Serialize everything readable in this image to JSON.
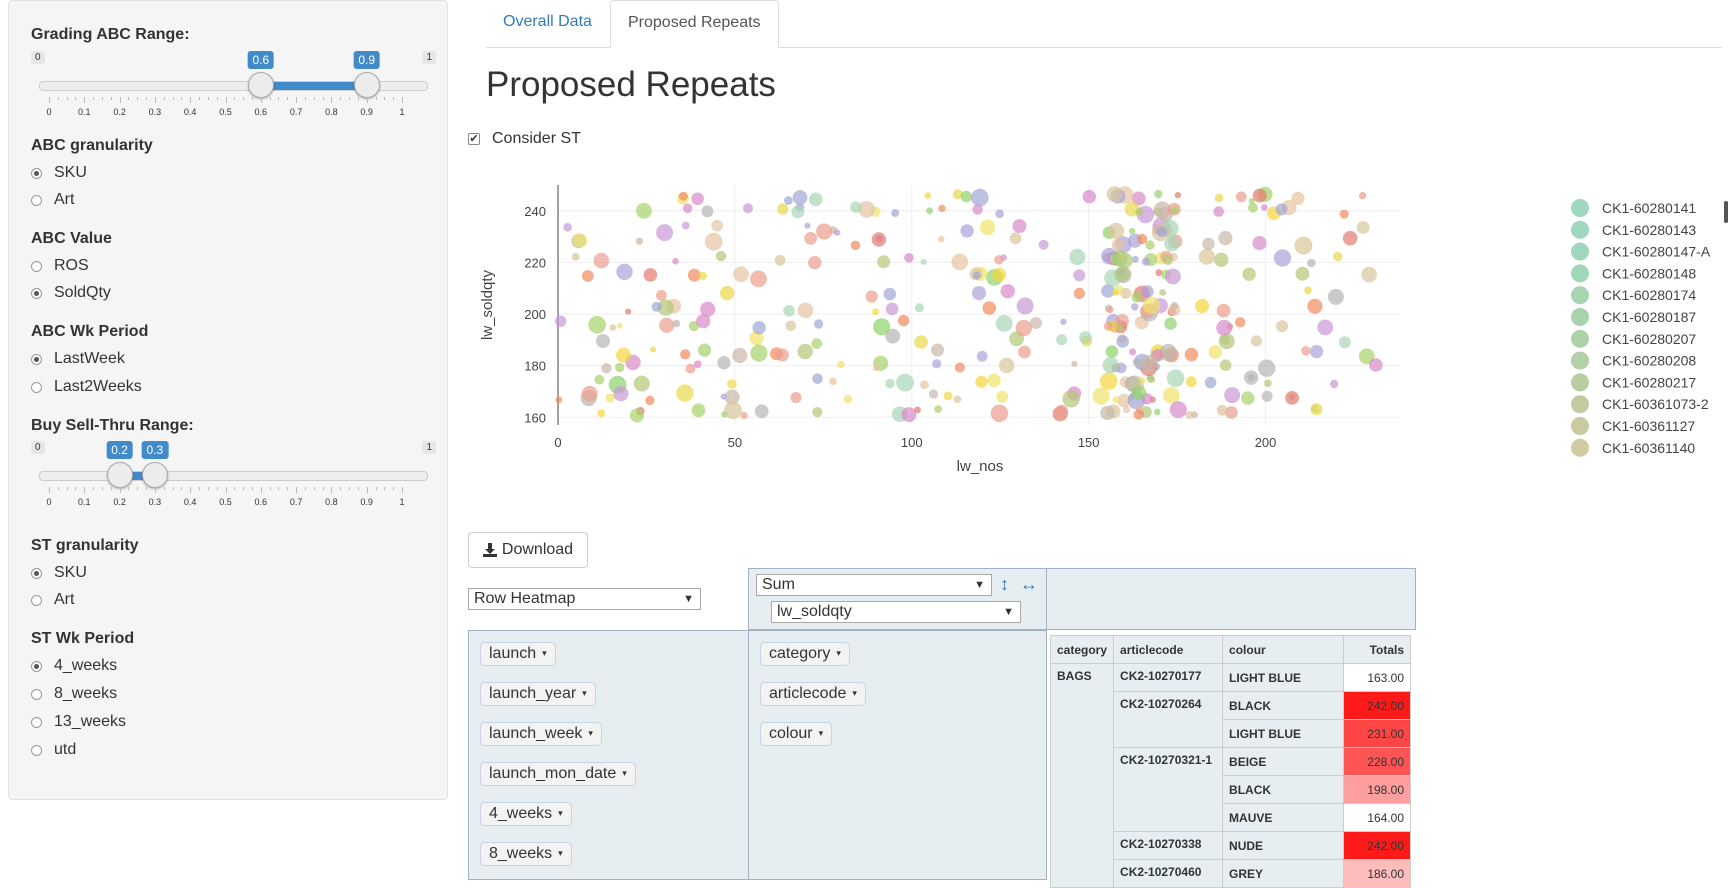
{
  "sidebar": {
    "grading_abc": {
      "label": "Grading ABC Range:",
      "min": "0",
      "max": "1",
      "low": "0.6",
      "high": "0.9",
      "low_value": 0.6,
      "high_value": 0.9
    },
    "ticks": [
      "0",
      "0.1",
      "0.2",
      "0.3",
      "0.4",
      "0.5",
      "0.6",
      "0.7",
      "0.8",
      "0.9",
      "1"
    ],
    "abc_granularity": {
      "label": "ABC granularity",
      "options": [
        "SKU",
        "Art"
      ],
      "selected": 0
    },
    "abc_value": {
      "label": "ABC Value",
      "options": [
        "ROS",
        "SoldQty"
      ],
      "selected": 1
    },
    "abc_wk_period": {
      "label": "ABC Wk Period",
      "options": [
        "LastWeek",
        "Last2Weeks"
      ],
      "selected": 0
    },
    "buy_sell_thru": {
      "label": "Buy Sell-Thru Range:",
      "min": "0",
      "max": "1",
      "low": "0.2",
      "high": "0.3",
      "low_value": 0.2,
      "high_value": 0.3
    },
    "st_granularity": {
      "label": "ST granularity",
      "options": [
        "SKU",
        "Art"
      ],
      "selected": 0
    },
    "st_wk_period": {
      "label": "ST Wk Period",
      "options": [
        "4_weeks",
        "8_weeks",
        "13_weeks",
        "utd"
      ],
      "selected": 0
    }
  },
  "tabs": [
    {
      "label": "Overall Data",
      "active": false
    },
    {
      "label": "Proposed Repeats",
      "active": true
    }
  ],
  "page_title": "Proposed Repeats",
  "consider_st": {
    "label": "Consider ST",
    "checked": true,
    "mark": "✔"
  },
  "chart_data": {
    "type": "scatter",
    "xlabel": "lw_nos",
    "ylabel": "lw_soldqty",
    "xlim": [
      0,
      238
    ],
    "ylim": [
      157,
      250
    ],
    "xticks": [
      "0",
      "50",
      "100",
      "150",
      "200"
    ],
    "yticks": [
      "160",
      "180",
      "200",
      "220",
      "240"
    ],
    "legend": [
      "CK1-60280141",
      "CK1-60280143",
      "CK1-60280147-A",
      "CK1-60280148",
      "CK1-60280174",
      "CK1-60280187",
      "CK1-60280207",
      "CK1-60280208",
      "CK1-60280217",
      "CK1-60361073-2",
      "CK1-60361127",
      "CK1-60361140"
    ],
    "legend_colors": [
      "#8ed1b4",
      "#8ed1b4",
      "#8fd0b0",
      "#91cfaa",
      "#96cea4",
      "#9acb9e",
      "#9fca99",
      "#a6c896",
      "#aec48f",
      "#b7c28e",
      "#c1c08f",
      "#c8bf92"
    ],
    "palette": [
      "#f0e36b",
      "#e9d94a",
      "#f2d63c",
      "#d8c49a",
      "#e6c3a3",
      "#c9b7a8",
      "#b3c777",
      "#a6d16a",
      "#8fd36b",
      "#f08a5d",
      "#e37b6d",
      "#eb9e8f",
      "#c899d6",
      "#d889c9",
      "#aaa3d8",
      "#9fa6d4",
      "#b5b5b5",
      "#a8d5b5"
    ]
  },
  "download": {
    "label": "Download"
  },
  "renderer": {
    "value": "Row Heatmap",
    "arrow": "▼"
  },
  "aggregator": {
    "value": "Sum",
    "arrow": "▼",
    "attr": "lw_soldqty",
    "vert": "↕",
    "horiz": "↔"
  },
  "rows_attrs": [
    "launch",
    "launch_year",
    "launch_week",
    "launch_mon_date",
    "4_weeks",
    "8_weeks"
  ],
  "col_attrs": [
    "category",
    "articlecode",
    "colour"
  ],
  "pill_arrow": "▾",
  "table": {
    "headers": [
      "category",
      "articlecode",
      "colour",
      "Totals"
    ],
    "category": "BAGS",
    "rows": [
      {
        "article": "CK2-10270177",
        "colour": "LIGHT BLUE",
        "value": "163.00",
        "heat": "#ffffff"
      },
      {
        "article": "CK2-10270264",
        "colour": "BLACK",
        "value": "242.00",
        "heat": "#ff1a1a"
      },
      {
        "article": "",
        "colour": "LIGHT BLUE",
        "value": "231.00",
        "heat": "#ff4646"
      },
      {
        "article": "CK2-10270321-1",
        "colour": "BEIGE",
        "value": "228.00",
        "heat": "#ff5454"
      },
      {
        "article": "",
        "colour": "BLACK",
        "value": "198.00",
        "heat": "#ff9e9e"
      },
      {
        "article": "",
        "colour": "MAUVE",
        "value": "164.00",
        "heat": "#ffffff"
      },
      {
        "article": "CK2-10270338",
        "colour": "NUDE",
        "value": "242.00",
        "heat": "#ff1a1a"
      },
      {
        "article": "CK2-10270460",
        "colour": "GREY",
        "value": "186.00",
        "heat": "#ffbcbc"
      }
    ]
  }
}
